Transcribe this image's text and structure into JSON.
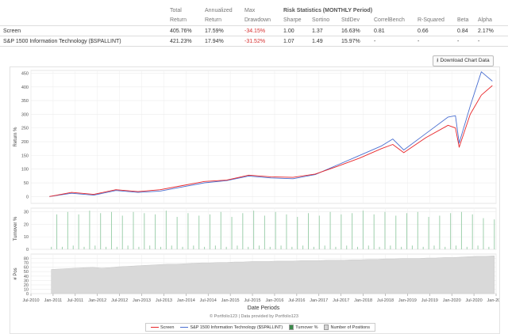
{
  "stats_table": {
    "columns": [
      {
        "l1": "Total",
        "l2": "Return"
      },
      {
        "l1": "Annualized",
        "l2": "Return"
      },
      {
        "l1": "Max",
        "l2": "Drawdown"
      },
      {
        "l1": "",
        "l2": "Sharpe"
      },
      {
        "l1": "",
        "l2": "Sortino"
      },
      {
        "l1": "",
        "l2": "StdDev"
      },
      {
        "l1": "",
        "l2": "CorrelBench"
      },
      {
        "l1": "",
        "l2": "R-Squared"
      },
      {
        "l1": "",
        "l2": "Beta"
      },
      {
        "l1": "",
        "l2": "Alpha"
      }
    ],
    "risk_title": "Risk Statistics (MONTHLY Period)",
    "rows": [
      {
        "name": "Screen",
        "values": [
          "405.76%",
          "17.59%",
          "-34.15%",
          "1.00",
          "1.37",
          "16.63%",
          "0.81",
          "0.66",
          "0.84",
          "2.17%"
        ]
      },
      {
        "name": "S&P 1500 Information Technology ($SPALLINT)",
        "values": [
          "421.23%",
          "17.94%",
          "-31.52%",
          "1.07",
          "1.49",
          "15.97%",
          "-",
          "-",
          "-",
          "-"
        ]
      }
    ]
  },
  "download_button": {
    "label": "Download Chart Data",
    "icon": "download-icon"
  },
  "footer_text": "© Portfolio123 | Data provided by Portfolio123",
  "legend": [
    {
      "label": "Screen",
      "color": "#e8262a",
      "kind": "line"
    },
    {
      "label": "S&P 1500 Information Technology ($SPALLINT)",
      "color": "#4a6fd1",
      "kind": "line"
    },
    {
      "label": "Turnover %",
      "color": "#3a8a4a",
      "kind": "box"
    },
    {
      "label": "Number of Positions",
      "color": "#d6d6d6",
      "kind": "box"
    }
  ],
  "chart_data": [
    {
      "type": "line",
      "ylabel": "Return %",
      "yticks": [
        0,
        50,
        100,
        150,
        200,
        250,
        300,
        350,
        400,
        450
      ],
      "ylim": [
        -25,
        460
      ],
      "x": [
        "2010-12",
        "2011-06",
        "2011-12",
        "2012-06",
        "2012-12",
        "2013-06",
        "2013-12",
        "2014-06",
        "2014-12",
        "2015-06",
        "2015-12",
        "2016-06",
        "2016-12",
        "2017-06",
        "2017-12",
        "2018-06",
        "2018-09",
        "2018-12",
        "2019-06",
        "2019-12",
        "2020-02",
        "2020-03",
        "2020-06",
        "2020-09",
        "2020-12"
      ],
      "series": [
        {
          "name": "Screen",
          "color": "#e8262a",
          "values": [
            0,
            15,
            8,
            25,
            18,
            25,
            40,
            55,
            60,
            78,
            72,
            70,
            82,
            110,
            140,
            175,
            190,
            160,
            215,
            260,
            250,
            180,
            300,
            370,
            405
          ]
        },
        {
          "name": "S&P 1500 Information Technology ($SPALLINT)",
          "color": "#4a6fd1",
          "values": [
            0,
            12,
            5,
            22,
            15,
            20,
            35,
            50,
            58,
            75,
            68,
            65,
            80,
            115,
            150,
            185,
            210,
            170,
            230,
            290,
            295,
            195,
            330,
            455,
            421
          ]
        }
      ]
    },
    {
      "type": "bar",
      "ylabel": "Turnover %",
      "yticks": [
        0,
        10,
        20,
        30
      ],
      "ylim": [
        0,
        33
      ],
      "values": [
        2,
        28,
        2,
        30,
        3,
        28,
        2,
        31,
        3,
        29,
        2,
        30,
        2,
        27,
        3,
        30,
        2,
        29,
        3,
        28,
        2,
        31,
        3,
        26,
        2,
        29,
        3,
        27,
        2,
        28,
        3,
        30,
        2,
        26,
        3,
        29,
        2,
        31,
        3,
        27,
        2,
        30,
        3,
        28,
        2,
        26,
        3,
        29,
        2,
        27,
        3,
        30,
        2,
        28,
        3,
        29,
        2,
        31,
        3,
        28,
        2,
        30,
        3,
        27,
        2,
        29,
        3,
        30,
        2,
        26,
        3,
        27,
        2,
        29,
        3,
        30,
        2,
        28,
        3,
        25,
        2,
        24
      ]
    },
    {
      "type": "area",
      "ylabel": "# Pos",
      "yticks": [
        0,
        10,
        20,
        30,
        40,
        50,
        60,
        70,
        80
      ],
      "ylim": [
        0,
        90
      ],
      "values": [
        55,
        56,
        57,
        58,
        59,
        60,
        58,
        59,
        61,
        62,
        63,
        64,
        65,
        66,
        67,
        67,
        68,
        69,
        70,
        70,
        71,
        71,
        72,
        72,
        73,
        73,
        73,
        74,
        74,
        74,
        75,
        75,
        75,
        76,
        76,
        76,
        77,
        77,
        78,
        78,
        79,
        79,
        80,
        80,
        80,
        81,
        81,
        82,
        82,
        83,
        84,
        85,
        85,
        86
      ]
    }
  ],
  "x_axis": {
    "label": "Date Periods",
    "ticks": [
      "Jul-2010",
      "Jan-2011",
      "Jul-2011",
      "Jan-2012",
      "Jul-2012",
      "Jan-2013",
      "Jul-2013",
      "Jan-2014",
      "Jul-2014",
      "Jan-2015",
      "Jul-2015",
      "Jan-2016",
      "Jul-2016",
      "Jan-2017",
      "Jul-2017",
      "Jan-2018",
      "Jul-2018",
      "Jan-2019",
      "Jul-2019",
      "Jan-2020",
      "Jul-2020",
      "Jan-2021"
    ]
  }
}
